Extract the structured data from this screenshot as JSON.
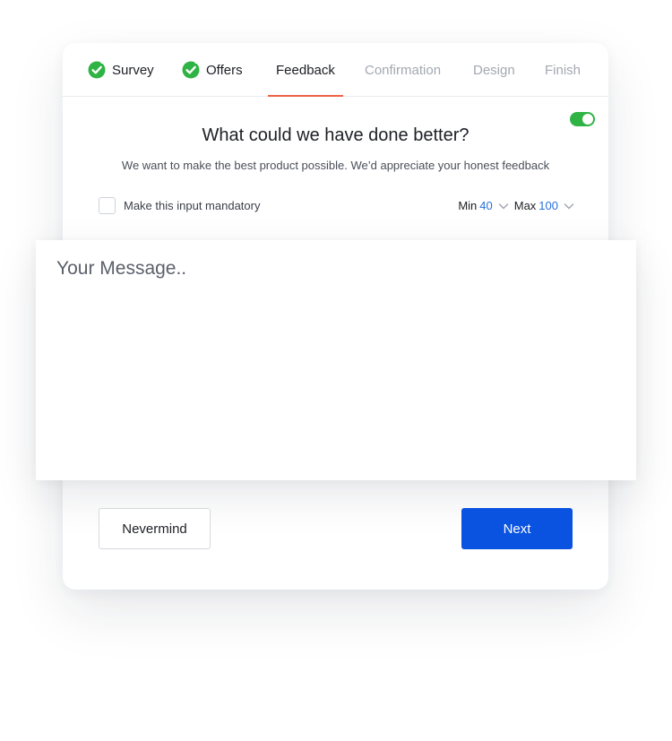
{
  "steps": [
    {
      "label": "Survey",
      "state": "done",
      "icon": "check-circle-icon"
    },
    {
      "label": "Offers",
      "state": "done",
      "icon": "check-circle-icon"
    },
    {
      "label": "Feedback",
      "state": "active"
    },
    {
      "label": "Confirmation",
      "state": "upcoming"
    },
    {
      "label": "Design",
      "state": "upcoming"
    },
    {
      "label": "Finish",
      "state": "upcoming"
    }
  ],
  "toggle": {
    "enabled": true
  },
  "question": {
    "title": "What could we have done better?",
    "subtitle": "We want to make the best product possible. We’d appreciate your honest feedback"
  },
  "mandatory": {
    "label": "Make this input mandatory",
    "checked": false
  },
  "limits": {
    "min_label": "Min",
    "min_value": "40",
    "max_label": "Max",
    "max_value": "100"
  },
  "message": {
    "placeholder": "Your Message..",
    "value": ""
  },
  "buttons": {
    "cancel": "Nevermind",
    "next": "Next"
  },
  "colors": {
    "accent_blue": "#0a52e0",
    "success_green": "#2fb344",
    "active_underline": "#ee6244",
    "link_blue": "#2a6fd8",
    "muted_text": "#a3a8b1"
  }
}
